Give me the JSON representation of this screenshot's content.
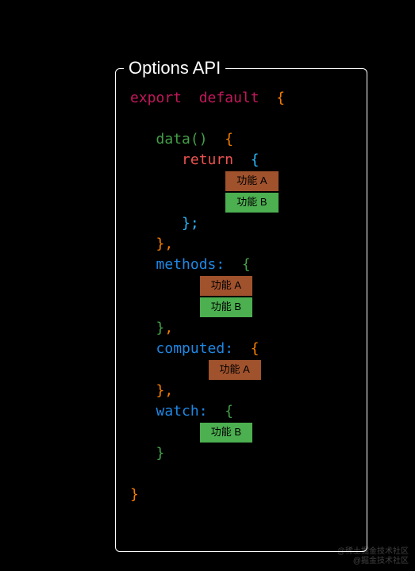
{
  "panel": {
    "title": "Options API"
  },
  "code": {
    "export": "export",
    "default": "default",
    "data": "data",
    "return": "return",
    "methods": "methods:",
    "computed": "computed:",
    "watch": "watch:"
  },
  "tags": {
    "featureA": "功能 A",
    "featureB": "功能 B"
  },
  "watermark": {
    "line1": "@稀土掘金技术社区",
    "line2": "@掘金技术社区"
  }
}
